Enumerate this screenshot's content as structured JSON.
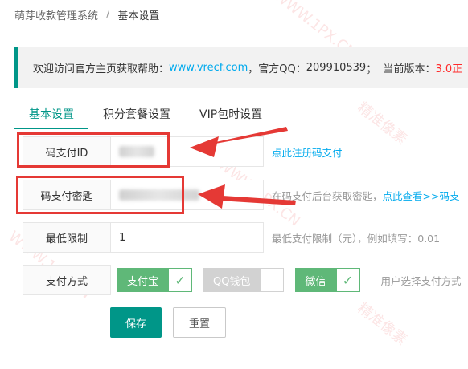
{
  "breadcrumb": {
    "root": "萌芽收款管理系统",
    "separator": "/",
    "current": "基本设置"
  },
  "notice": {
    "prefix": "欢迎访问官方主页获取帮助：",
    "site": "www.vrecf.com",
    "qq_label": "，官方QQ：",
    "qq": "209910539",
    "version_label": "；  当前版本：",
    "version": "3.0正"
  },
  "tabs": [
    {
      "label": "基本设置",
      "active": true
    },
    {
      "label": "积分套餐设置",
      "active": false
    },
    {
      "label": "VIP包时设置",
      "active": false
    }
  ],
  "form": {
    "codepay_id": {
      "label": "码支付ID",
      "link": "点此注册码支付"
    },
    "codepay_key": {
      "label": "码支付密匙",
      "hint": "在码支付后台获取密匙，",
      "link": "点此查看>>码支"
    },
    "min_limit": {
      "label": "最低限制",
      "value": "1",
      "hint": "最低支付限制（元），例如填写：0.01"
    },
    "pay_method": {
      "label": "支付方式",
      "options": [
        {
          "label": "支付宝",
          "checked": true
        },
        {
          "label": "QQ钱包",
          "checked": false
        },
        {
          "label": "微信",
          "checked": true
        }
      ],
      "hint": "用户选择支付方式"
    }
  },
  "buttons": {
    "save": "保存",
    "reset": "重置"
  },
  "watermark": {
    "text1": "精准像素",
    "text2": "WWW.1PX.CN"
  },
  "colors": {
    "primary": "#009688",
    "link": "#01AAED",
    "check": "#5FB878",
    "annotation": "#e53935"
  }
}
